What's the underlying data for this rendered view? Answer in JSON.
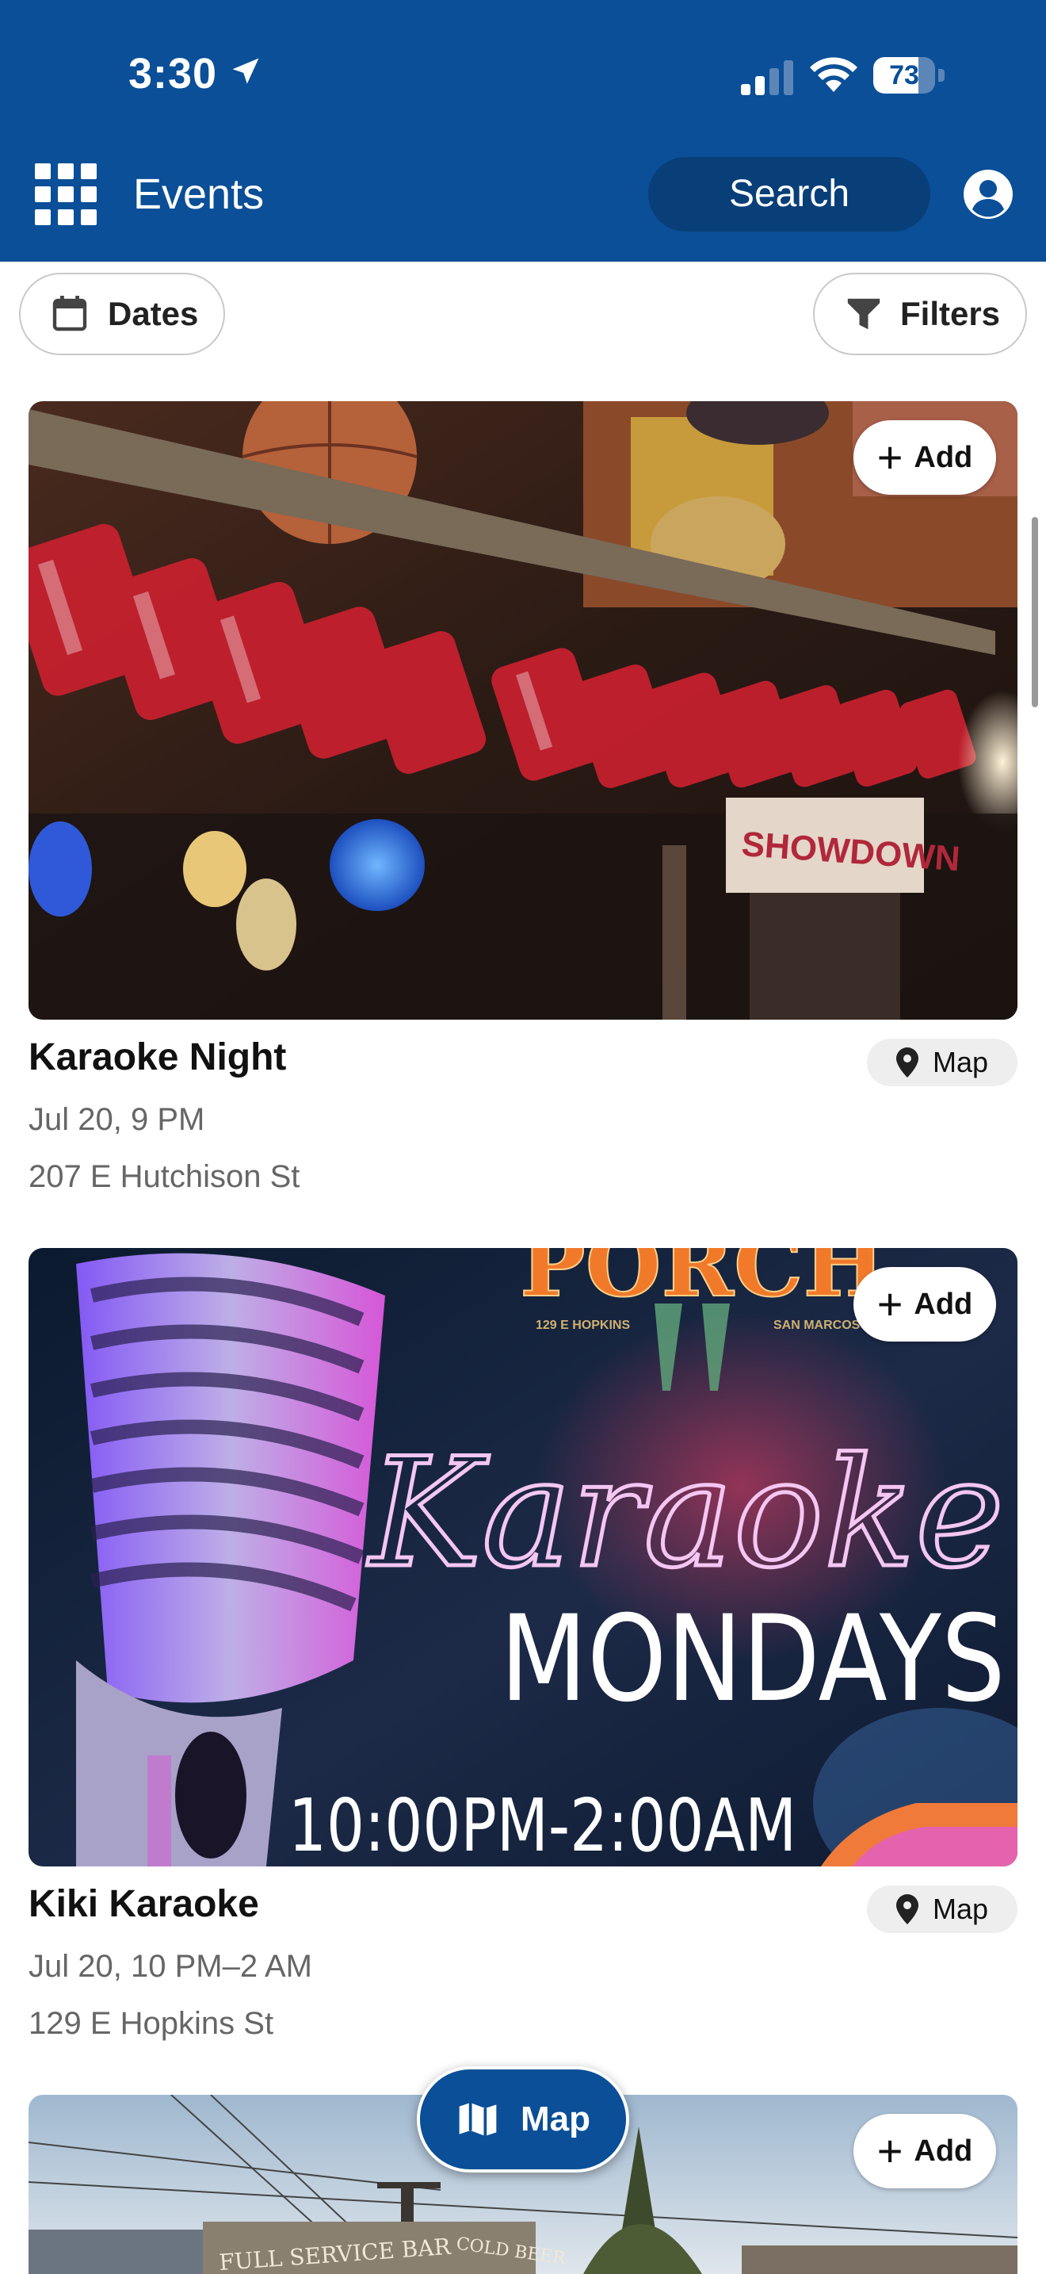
{
  "status_bar": {
    "time": "3:30",
    "battery": "73",
    "battery_level": 0.73
  },
  "header": {
    "title": "Events",
    "search_label": "Search"
  },
  "filters": {
    "dates_label": "Dates",
    "filters_label": "Filters"
  },
  "events": [
    {
      "title": "Karaoke Night",
      "date": "Jul 20, 9 PM",
      "address": "207 E Hutchison St",
      "add_label": "Add",
      "map_label": "Map",
      "image_text": "SHOWDOWN"
    },
    {
      "title": "Kiki Karaoke",
      "date": "Jul 20, 10 PM–2 AM",
      "address": "129 E Hopkins St",
      "add_label": "Add",
      "map_label": "Map",
      "image_text": {
        "venue": "PORCH",
        "venue_address": "129 E HOPKINS",
        "city": "SAN MARCOS",
        "script": "Karaoke",
        "headline": "MONDAYS",
        "hours": "10:00PM-2:00AM"
      }
    },
    {
      "add_label": "Add",
      "image_text": {
        "sign_left": "FULL SERVICE BAR",
        "sign_right": "COLD BEER"
      }
    }
  ],
  "fab": {
    "label": "Map"
  },
  "colors": {
    "primary": "#0a4f97",
    "search_bg": "#083f78"
  }
}
